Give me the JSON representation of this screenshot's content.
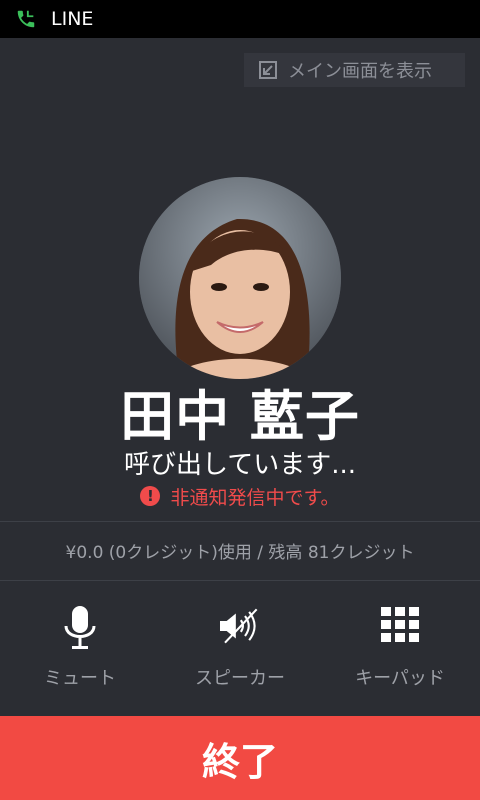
{
  "status": {
    "app_name": "LINE",
    "icon": "phone-icon"
  },
  "header": {
    "main_screen_label": "メイン画面を表示",
    "icon": "return-to-main-icon"
  },
  "contact": {
    "name": "田中 藍子",
    "call_state": "呼び出しています...",
    "warning": "非通知発信中です。",
    "warning_mark": "!"
  },
  "billing": {
    "credit_text": "¥0.0 (0クレジット)使用 / 残高 81クレジット"
  },
  "controls": {
    "mute_label": "ミュート",
    "speaker_label": "スピーカー",
    "keypad_label": "キーパッド"
  },
  "end_button": {
    "label": "終了"
  },
  "colors": {
    "accent_red": "#f24a43",
    "background": "#2b2d33",
    "line_green": "#3bbf5a"
  }
}
